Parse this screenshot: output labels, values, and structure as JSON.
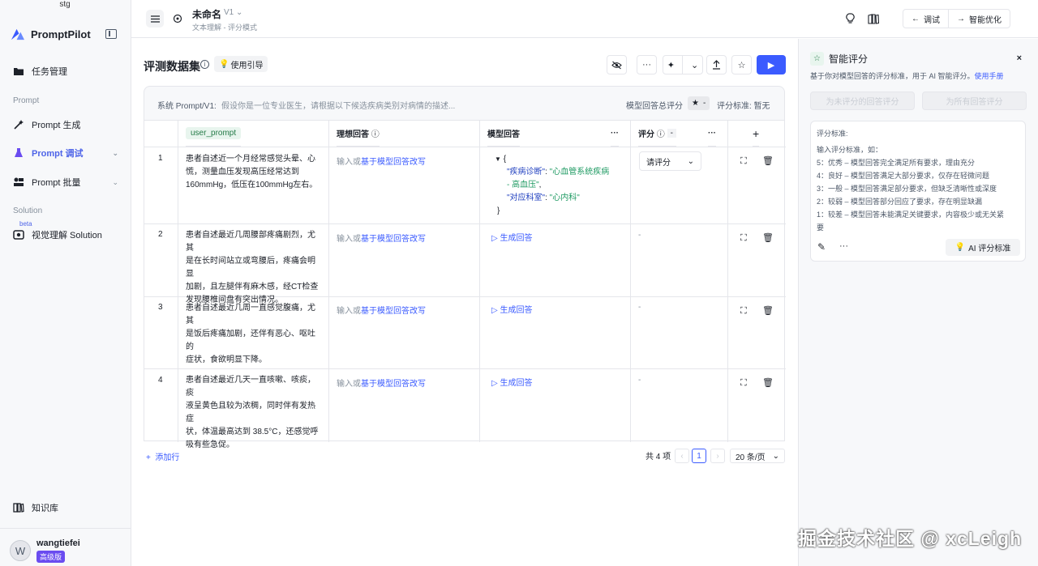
{
  "env": "stg",
  "brand": "PromptPilot",
  "sidebar": {
    "items": [
      {
        "label": "任务管理"
      },
      {
        "label": "Prompt 生成"
      },
      {
        "label": "Prompt 调试"
      },
      {
        "label": "Prompt 批量"
      },
      {
        "label": "视觉理解 Solution"
      },
      {
        "label": "知识库"
      }
    ],
    "section_prompt": "Prompt",
    "section_solution": "Solution",
    "beta": "beta"
  },
  "user": {
    "initial": "W",
    "name": "wangtiefei",
    "plan": "高级版"
  },
  "header": {
    "title": "未命名",
    "version": "V1",
    "subtitle": "文本理解 - 评分模式",
    "debug": "调试",
    "optimize": "智能优化"
  },
  "main": {
    "title": "评测数据集",
    "guide": "使用引导",
    "sys_label": "系统 Prompt/V1:",
    "sys_text": "假设你是一位专业医生，请根据以下候选疾病类别对病情的描述...",
    "score_total_label": "模型回答总评分",
    "score_total_value": "-",
    "criteria_label": "评分标准: 暂无"
  },
  "table": {
    "headers": {
      "prompt": "user_prompt",
      "ideal": "理想回答",
      "model": "模型回答",
      "score": "评分",
      "score_value": "-"
    },
    "ideal_prefix": "输入或",
    "ideal_link": "基于模型回答改写",
    "generate": "生成回答",
    "select_placeholder": "请评分",
    "empty": "-",
    "rows": [
      {
        "num": "1",
        "line1": "患者自述近一个月经常感觉头晕、心",
        "line2": "慌，测量血压发现高压经常达到",
        "line3": "160mmHg，低压在100mmHg左右。",
        "line4": ""
      },
      {
        "num": "2",
        "line1": "患者自述最近几周腰部疼痛剧烈，尤其",
        "line2": "是在长时间站立或弯腰后，疼痛会明显",
        "line3": "加剧，且左腿伴有麻木感，经CT检查",
        "line4": "发现腰椎间盘有突出情况。"
      },
      {
        "num": "3",
        "line1": "患者自述最近几周一直感觉腹痛，尤其",
        "line2": "是饭后疼痛加剧，还伴有恶心、呕吐的",
        "line3": "症状，食欲明显下降。",
        "line4": ""
      },
      {
        "num": "4",
        "line1": "患者自述最近几天一直咳嗽、咳痰，痰",
        "line2": "液呈黄色且较为浓稠，同时伴有发热症",
        "line3": "状，体温最高达到 38.5°C，还感觉呼",
        "line4": "吸有些急促。"
      }
    ],
    "json": {
      "open": "{",
      "k1": "\"疾病诊断\"",
      "v1a": "\"心血管系统疾病",
      "v1b": "- 高血压\"",
      "k2": "\"对应科室\"",
      "v2": "\"心内科\"",
      "close": "}"
    }
  },
  "footer": {
    "add_row": "添加行",
    "total": "共 4 项",
    "page": "1",
    "page_size": "20 条/页"
  },
  "panel": {
    "title": "智能评分",
    "desc": "基于你对模型回答的评分标准，用于 AI 智能评分。",
    "manual": "使用手册",
    "btn_unscored": "为未评分的回答评分",
    "btn_all": "为所有回答评分",
    "criteria_title": "评分标准:",
    "criteria_hint": "输入评分标准，如：",
    "lines": [
      "5：优秀 – 模型回答完全满足所有要求，理由充分",
      "4：良好 – 模型回答满足大部分要求，仅存在轻微问题",
      "3：一般 – 模型回答满足部分要求，但缺乏清晰性或深度",
      "2：较弱 – 模型回答部分回应了要求，存在明显缺漏",
      "1：较差 – 模型回答未能满足关键要求，内容极少或无关紧",
      "要"
    ],
    "ai_btn": "AI 评分标准"
  },
  "watermark": "掘金技术社区 @ xcLeigh"
}
